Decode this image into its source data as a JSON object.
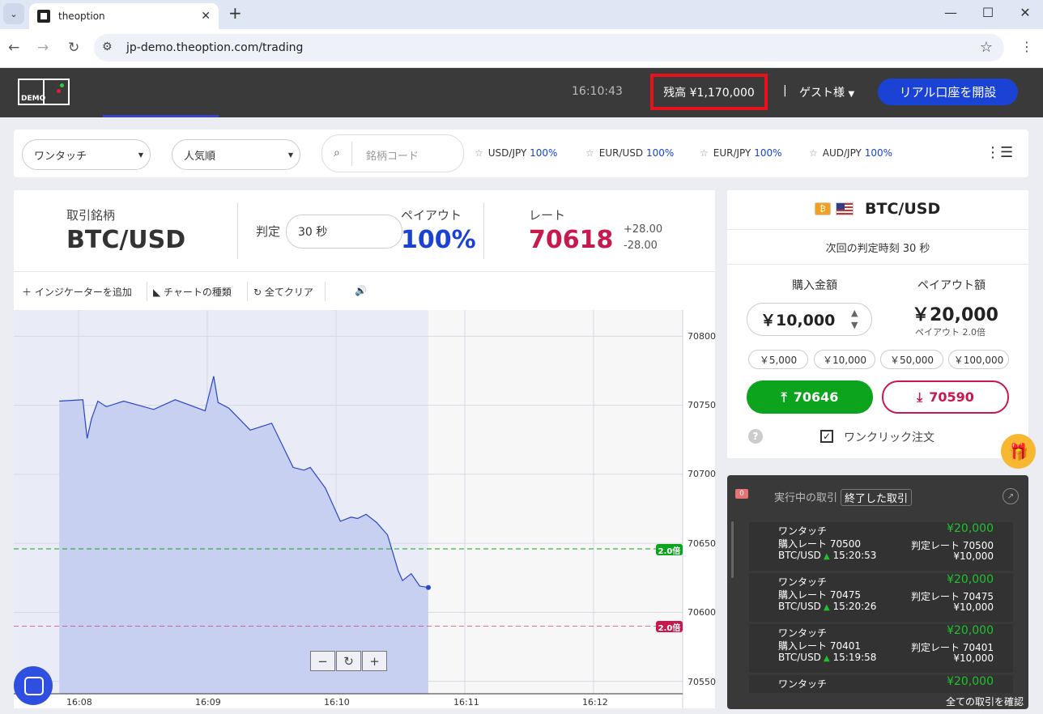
{
  "browser": {
    "tab_title": "theoption",
    "url": "jp-demo.theoption.com/trading"
  },
  "header": {
    "logo_text": "DEMO",
    "clock": "16:10:43",
    "balance": "残高 ¥1,170,000",
    "separator": "|",
    "guest": "ゲスト様",
    "open_account": "リアル口座を開設"
  },
  "filters": {
    "type_select": "ワンタッチ",
    "sort_select": "人気順",
    "search_placeholder": "銘柄コード",
    "favorites": [
      {
        "pair": "USD/JPY",
        "pct": "100%"
      },
      {
        "pair": "EUR/USD",
        "pct": "100%"
      },
      {
        "pair": "EUR/JPY",
        "pct": "100%"
      },
      {
        "pair": "AUD/JPY",
        "pct": "100%"
      }
    ]
  },
  "info": {
    "symbol_label": "取引銘柄",
    "symbol": "BTC/USD",
    "judge_label": "判定",
    "judge_value": "30 秒",
    "payout_label": "ペイアウト",
    "payout_value": "100%",
    "rate_label": "レート",
    "rate_value": "70618",
    "delta_up": "+28.00",
    "delta_down": "-28.00"
  },
  "chart_tools": {
    "add_indicator": "インジケーターを追加",
    "chart_type": "チャートの種類",
    "clear_all": "全てクリア"
  },
  "chart_data": {
    "type": "area",
    "y_ticks": [
      "70800",
      "70750",
      "70700",
      "70650",
      "70600",
      "70550"
    ],
    "x_ticks": [
      "16:08",
      "16:09",
      "16:10",
      "16:11",
      "16:12"
    ],
    "ylim": [
      70541,
      70819
    ],
    "upper_line": 70646,
    "lower_line": 70590,
    "upper_tag": "2.0倍",
    "lower_tag": "2.0倍",
    "colors": {
      "fill": "#c7d0f0",
      "line": "#2a45c8",
      "upper": "#0ca41d",
      "lower": "#c8194e"
    },
    "x": [
      "16:07:51",
      "16:08:02",
      "16:08:04",
      "16:08:06",
      "16:08:09",
      "16:08:13",
      "16:08:21",
      "16:08:35",
      "16:08:45",
      "16:08:59",
      "16:09:03",
      "16:09:05",
      "16:09:10",
      "16:09:20",
      "16:09:30",
      "16:09:40",
      "16:09:45",
      "16:09:48",
      "16:09:55",
      "16:10:02",
      "16:10:07",
      "16:10:10",
      "16:10:14",
      "16:10:19",
      "16:10:24",
      "16:10:29",
      "16:10:31",
      "16:10:35",
      "16:10:39",
      "16:10:43"
    ],
    "values": [
      70753,
      70754,
      70726,
      70740,
      70753,
      70749,
      70753,
      70747,
      70754,
      70746,
      70771,
      70752,
      70748,
      70732,
      70737,
      70705,
      70703,
      70705,
      70690,
      70666,
      70669,
      70668,
      70671,
      70665,
      70656,
      70630,
      70623,
      70628,
      70619,
      70618
    ]
  },
  "order": {
    "pair": "BTC/USD",
    "btc_glyph": "₿",
    "next_judge": "次回の判定時刻 30 秒",
    "amount_label": "購入金額",
    "payout_label": "ペイアウト額",
    "amount": "￥10,000",
    "payout_amount": "￥20,000",
    "payout_mult": "ペイアウト 2.0倍",
    "chips": [
      "￥5,000",
      "￥10,000",
      "￥50,000",
      "￥100,000"
    ],
    "up_rate": "70646",
    "down_rate": "70590",
    "one_click": "ワンクリック注文"
  },
  "trades": {
    "badge": "0",
    "tab_running": "実行中の取引",
    "tab_finished": "終了した取引",
    "see_all": "全ての取引を確認",
    "rows": [
      {
        "type": "ワンタッチ",
        "buy_rate": "購入レート 70500",
        "pair": "BTC/USD",
        "time": "15:20:53",
        "payout": "¥20,000",
        "judge_rate": "判定レート 70500",
        "amount": "¥10,000"
      },
      {
        "type": "ワンタッチ",
        "buy_rate": "購入レート 70475",
        "pair": "BTC/USD",
        "time": "15:20:26",
        "payout": "¥20,000",
        "judge_rate": "判定レート 70475",
        "amount": "¥10,000"
      },
      {
        "type": "ワンタッチ",
        "buy_rate": "購入レート 70401",
        "pair": "BTC/USD",
        "time": "15:19:58",
        "payout": "¥20,000",
        "judge_rate": "判定レート 70401",
        "amount": "¥10,000"
      },
      {
        "type": "ワンタッチ",
        "payout": "¥20,000"
      }
    ]
  }
}
